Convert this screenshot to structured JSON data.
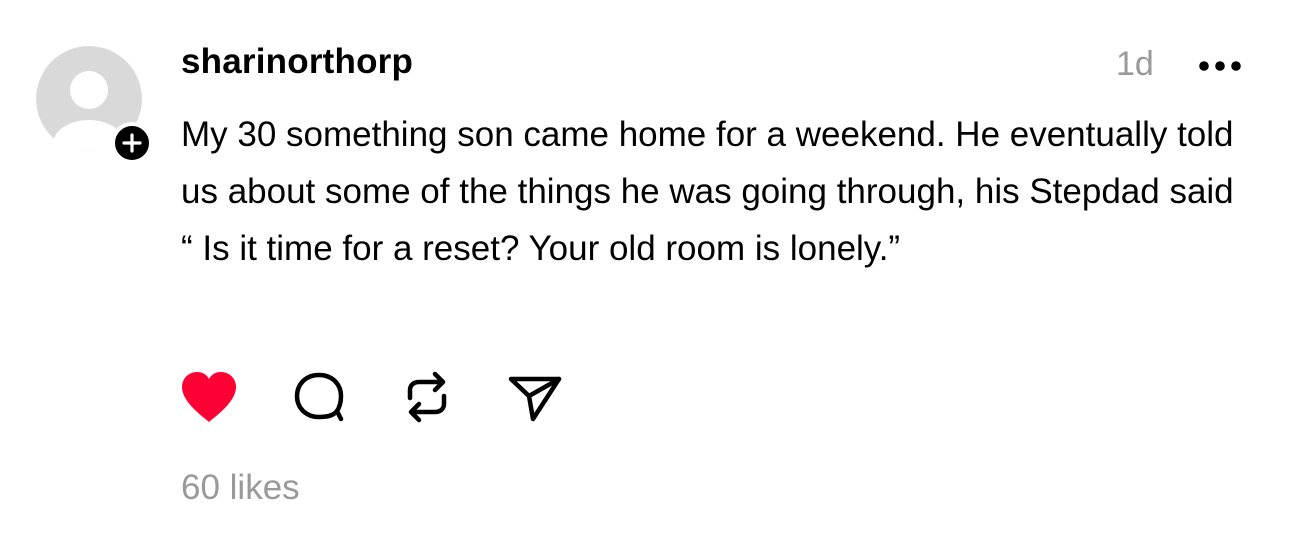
{
  "post": {
    "username": "sharinorthorp",
    "timestamp": "1d",
    "text": "My 30 something son came home for a weekend. He eventually told us about some of the things he was going through, his Stepdad said “ Is it time for a reset? Your old room is lonely.”",
    "likes_label": "60 likes",
    "liked": true
  },
  "icons": {
    "avatar": "default-avatar-icon",
    "follow": "plus-icon",
    "more": "ellipsis-icon",
    "like": "heart-icon",
    "comment": "comment-icon",
    "repost": "repost-icon",
    "share": "send-icon"
  },
  "colors": {
    "like_red": "#FF0034",
    "muted_text": "#999999",
    "text": "#000000",
    "avatar_bg": "#D9D9D9"
  }
}
